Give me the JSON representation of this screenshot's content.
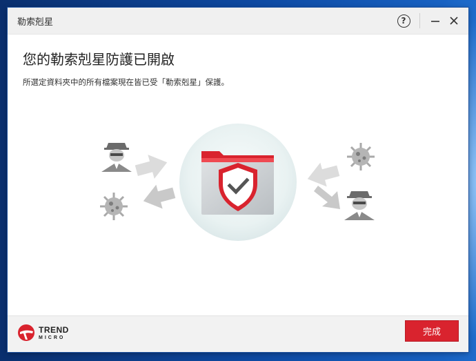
{
  "window": {
    "title": "勒索剋星",
    "controls": {
      "help_glyph": "?"
    }
  },
  "main": {
    "heading": "您的勒索剋星防護已開啟",
    "description": "所選定資料夾中的所有檔案現在皆已受「勒索剋星」保護。"
  },
  "illustration": {
    "center_icon": "shield-folder-check-icon",
    "left_icons": [
      "hacker-icon",
      "virus-icon"
    ],
    "right_icons": [
      "virus-icon",
      "hacker-icon"
    ],
    "colors": {
      "accent_red": "#d9232e",
      "folder_gray": "#cfd3d6",
      "circle_bg": "#e8f1f1"
    }
  },
  "footer": {
    "brand_line1": "TREND",
    "brand_line2": "MICRO",
    "done_label": "完成"
  }
}
